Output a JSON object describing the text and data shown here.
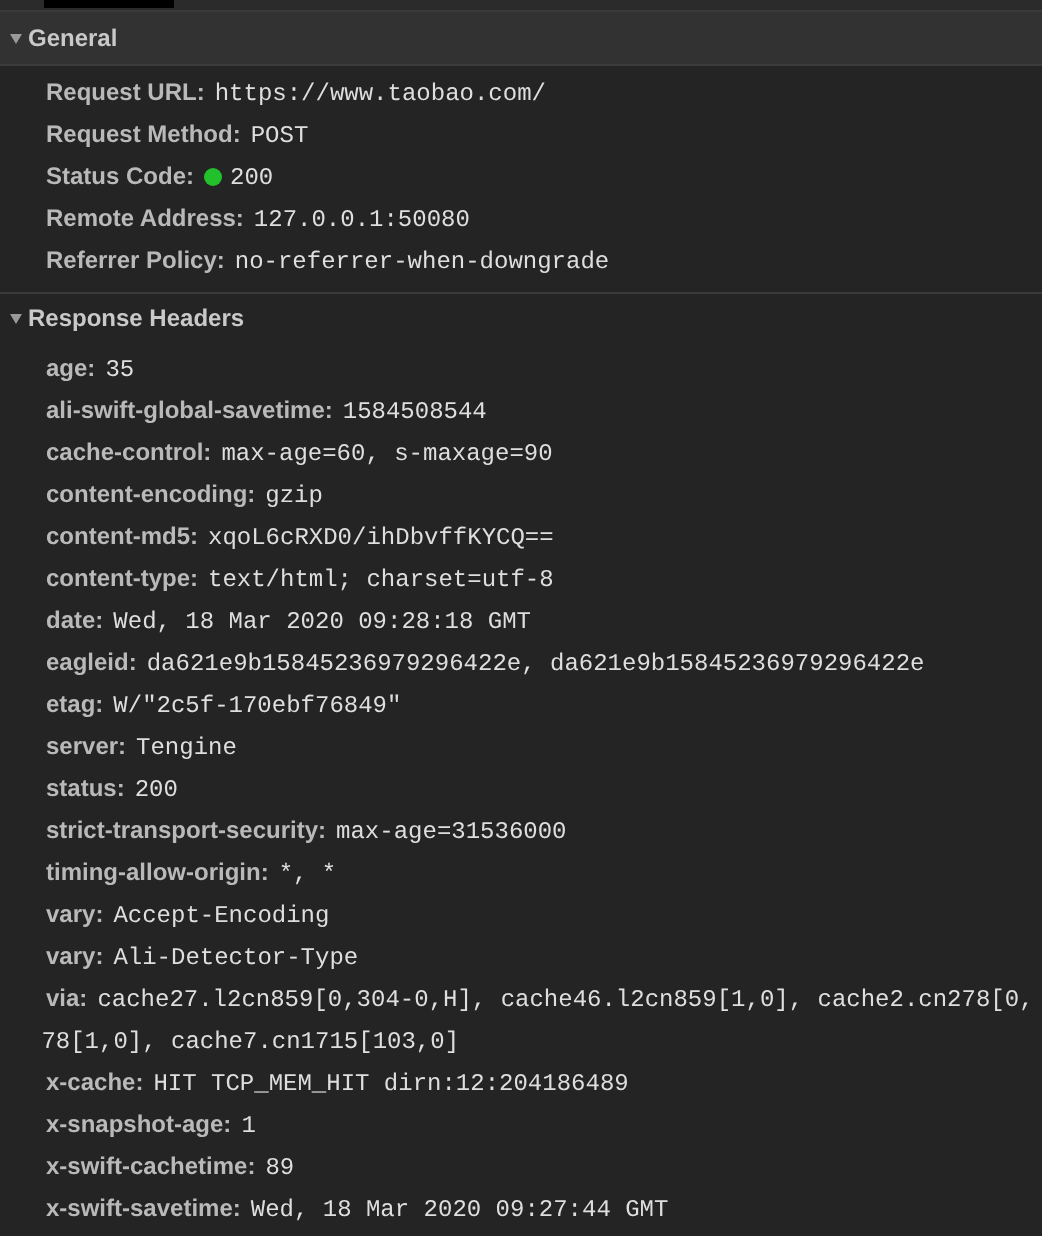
{
  "sections": [
    {
      "title": "General",
      "expanded": true,
      "rows": [
        {
          "name": "Request URL:",
          "value": [
            "https://www.taobao.com/"
          ]
        },
        {
          "name": "Request Method:",
          "value": [
            "POST"
          ]
        },
        {
          "name": "Status Code:",
          "color": "#22c02b",
          "value": [
            "200"
          ]
        },
        {
          "name": "Remote Address:",
          "value": [
            "127.0.0.1:50080"
          ]
        },
        {
          "name": "Referrer Policy:",
          "value": [
            "no-referrer-when-downgrade"
          ]
        }
      ]
    },
    {
      "title": "Response Headers",
      "expanded": true,
      "rows": [
        {
          "name": "age:",
          "value": [
            "35"
          ]
        },
        {
          "name": "ali-swift-global-savetime:",
          "value": [
            "1584508544"
          ]
        },
        {
          "name": "cache-control:",
          "value": [
            "max-age=60, s-maxage=90"
          ]
        },
        {
          "name": "content-encoding:",
          "value": [
            "gzip"
          ]
        },
        {
          "name": "content-md5:",
          "value": [
            "xqoL6cRXD0/ihDbvffKYCQ=="
          ]
        },
        {
          "name": "content-type:",
          "value": [
            "text/html; charset=utf-8"
          ]
        },
        {
          "name": "date:",
          "value": [
            "Wed, 18 Mar 2020 09:28:18 GMT"
          ]
        },
        {
          "name": "eagleid:",
          "value": [
            "da621e9b15845236979296422e, da621e9b15845236979296422e"
          ]
        },
        {
          "name": "etag:",
          "value": [
            "W/\"2c5f-170ebf76849\""
          ]
        },
        {
          "name": "server:",
          "value": [
            "Tengine"
          ]
        },
        {
          "name": "status:",
          "value": [
            "200"
          ]
        },
        {
          "name": "strict-transport-security:",
          "value": [
            "max-age=31536000"
          ]
        },
        {
          "name": "timing-allow-origin:",
          "value": [
            "*, *"
          ]
        },
        {
          "name": "vary:",
          "value": [
            "Accept-Encoding"
          ]
        },
        {
          "name": "vary:",
          "value": [
            "Ali-Detector-Type"
          ]
        },
        {
          "name": "via:",
          "value": [
            "cache27.l2cn859[0,304-0,H], cache46.l2cn859[1,0], cache2.cn278[0,",
            "78[1,0], cache7.cn1715[103,0]"
          ]
        },
        {
          "name": "x-cache:",
          "value": [
            "HIT TCP_MEM_HIT dirn:12:204186489"
          ]
        },
        {
          "name": "x-snapshot-age:",
          "value": [
            "1"
          ]
        },
        {
          "name": "x-swift-cachetime:",
          "value": [
            "89"
          ]
        },
        {
          "name": "x-swift-savetime:",
          "value": [
            "Wed, 18 Mar 2020 09:27:44 GMT"
          ]
        }
      ]
    }
  ]
}
